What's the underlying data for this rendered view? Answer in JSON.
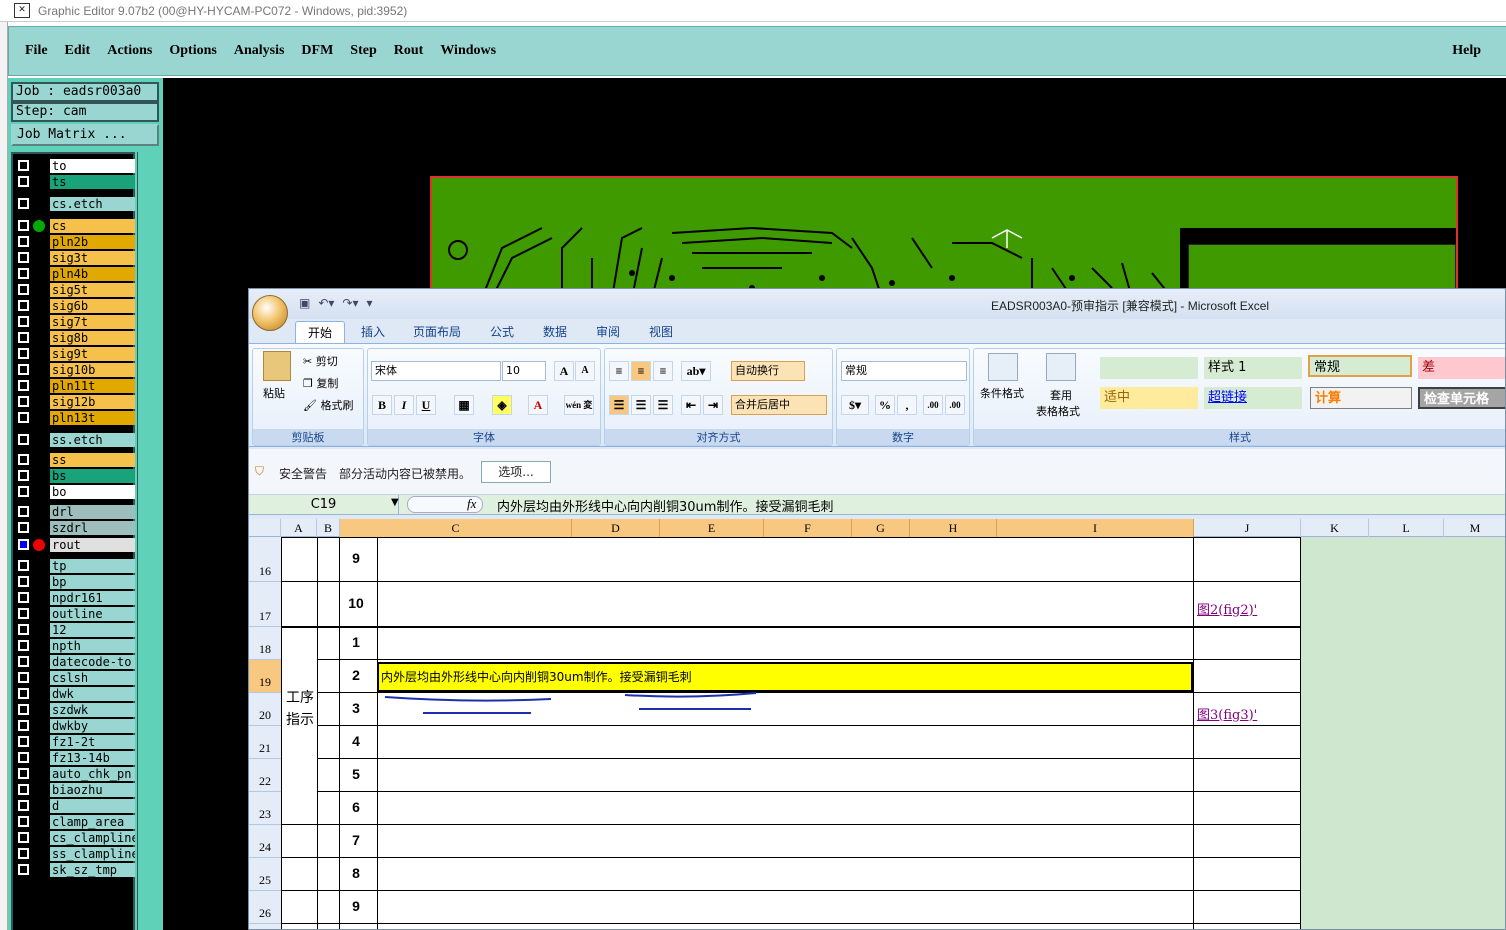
{
  "window": {
    "title": "Graphic Editor 9.07b2 (00@HY-HYCAM-PC072 - Windows, pid:3952)",
    "logo": "GE"
  },
  "menubar": {
    "items": [
      "File",
      "Edit",
      "Actions",
      "Options",
      "Analysis",
      "DFM",
      "Step",
      "Rout",
      "Windows"
    ],
    "help": "Help",
    "bg": "#9ad6d1"
  },
  "job": {
    "job_line": "Job : eadsr003a0",
    "step_line": "Step: cam",
    "matrix_button": "Job Matrix ..."
  },
  "layers": [
    {
      "name": "to",
      "bg": "#ffffff"
    },
    {
      "name": "ts",
      "bg": "#1aa37a"
    },
    {
      "name": "cs.etch",
      "bg": "#9ad6d1"
    },
    {
      "name": "cs",
      "bg": "#f6c14a",
      "dot": "#0a0"
    },
    {
      "name": "pln2b",
      "bg": "#e0a800"
    },
    {
      "name": "sig3t",
      "bg": "#f6c14a"
    },
    {
      "name": "pln4b",
      "bg": "#e0a800"
    },
    {
      "name": "sig5t",
      "bg": "#f6c14a"
    },
    {
      "name": "sig6b",
      "bg": "#f6c14a"
    },
    {
      "name": "sig7t",
      "bg": "#f6c14a"
    },
    {
      "name": "sig8b",
      "bg": "#f6c14a"
    },
    {
      "name": "sig9t",
      "bg": "#f6c14a"
    },
    {
      "name": "sig10b",
      "bg": "#f6c14a"
    },
    {
      "name": "pln11t",
      "bg": "#e0a800"
    },
    {
      "name": "sig12b",
      "bg": "#f6c14a"
    },
    {
      "name": "pln13t",
      "bg": "#e0a800"
    },
    {
      "name": "ss.etch",
      "bg": "#9ad6d1"
    },
    {
      "name": "ss",
      "bg": "#f6c14a"
    },
    {
      "name": "bs",
      "bg": "#1aa37a"
    },
    {
      "name": "bo",
      "bg": "#ffffff"
    },
    {
      "name": "drl",
      "bg": "#9ebdbd"
    },
    {
      "name": "szdrl",
      "bg": "#9ebdbd"
    },
    {
      "name": "rout",
      "bg": "#e0e0e0",
      "dot": "#e00",
      "blue": true
    },
    {
      "name": "tp",
      "bg": "#9ad6d1"
    },
    {
      "name": "bp",
      "bg": "#9ad6d1"
    },
    {
      "name": "npdr161",
      "bg": "#9ad6d1"
    },
    {
      "name": "outline",
      "bg": "#9ad6d1"
    },
    {
      "name": "12",
      "bg": "#9ad6d1"
    },
    {
      "name": "npth",
      "bg": "#9ad6d1"
    },
    {
      "name": "datecode-to",
      "bg": "#9ad6d1"
    },
    {
      "name": "cslsh",
      "bg": "#9ad6d1"
    },
    {
      "name": "dwk",
      "bg": "#9ad6d1"
    },
    {
      "name": "szdwk",
      "bg": "#9ad6d1"
    },
    {
      "name": "dwkby",
      "bg": "#9ad6d1"
    },
    {
      "name": "fz1-2t",
      "bg": "#9ad6d1"
    },
    {
      "name": "fz13-14b",
      "bg": "#9ad6d1"
    },
    {
      "name": "auto_chk_pn",
      "bg": "#9ad6d1"
    },
    {
      "name": "biaozhu",
      "bg": "#9ad6d1"
    },
    {
      "name": "d",
      "bg": "#9ad6d1"
    },
    {
      "name": "clamp_area",
      "bg": "#9ad6d1"
    },
    {
      "name": "cs_clampline",
      "bg": "#9ad6d1"
    },
    {
      "name": "ss_clampline",
      "bg": "#9ad6d1"
    },
    {
      "name": "sk_sz_tmp",
      "bg": "#9ad6d1"
    }
  ],
  "excel": {
    "title": "EADSR003A0-预审指示 [兼容模式] - Microsoft Excel",
    "tabs": [
      "开始",
      "插入",
      "页面布局",
      "公式",
      "数据",
      "审阅",
      "视图"
    ],
    "clipboard": {
      "paste": "粘贴",
      "cut": "剪切",
      "copy": "复制",
      "format_painter": "格式刷",
      "label": "剪贴板"
    },
    "font": {
      "name": "宋体",
      "size": "10",
      "label": "字体",
      "bold": "B",
      "italic": "I",
      "underline": "U",
      "grow": "A",
      "shrink": "A",
      "color": "A",
      "wen": "wén 変"
    },
    "alignment": {
      "wrap": "自动换行",
      "merge": "合并后居中",
      "label": "对齐方式"
    },
    "number": {
      "format": "常规",
      "label": "数字",
      "percent": "%",
      "comma": ",",
      "inc": ".00",
      "dec": ".00"
    },
    "styles_group": {
      "cond": "条件格式",
      "table1": "套用",
      "table2": "表格格式",
      "label": "样式"
    },
    "styles": [
      {
        "text": "",
        "bg": "#d6ecd2",
        "fg": "#000"
      },
      {
        "text": "样式 1",
        "bg": "#d6ecd2",
        "fg": "#000"
      },
      {
        "text": "常规",
        "bg": "#d6ecd2",
        "fg": "#000"
      },
      {
        "text": "差",
        "bg": "#ffc7ce",
        "fg": "#9c0006"
      },
      {
        "text": "适中",
        "bg": "#ffeb9c",
        "fg": "#9c6500"
      },
      {
        "text": "超链接",
        "bg": "#d6ecd2",
        "fg": "#0000ff"
      },
      {
        "text": "计算",
        "bg": "#f2f2f2",
        "fg": "#fa7d00"
      },
      {
        "text": "检查单元格",
        "bg": "#a5a5a5",
        "fg": "#fff"
      }
    ],
    "security": {
      "label": "安全警告",
      "message": "部分活动内容已被禁用。",
      "options": "选项..."
    },
    "formula": {
      "cellref": "C19",
      "fx": "fx",
      "content": "内外层均由外形线中心向内削铜30um制作。接受漏铜毛刺"
    },
    "columns": [
      "A",
      "B",
      "C",
      "D",
      "E",
      "F",
      "G",
      "H",
      "I",
      "J",
      "K",
      "L",
      "M"
    ],
    "rows": [
      {
        "num": "16",
        "b": "9"
      },
      {
        "num": "17",
        "b": "10",
        "link": "图2(fig2)'"
      },
      {
        "num": "18",
        "b": "1"
      },
      {
        "num": "19",
        "b": "2",
        "text": "内外层均由外形线中心向内削铜30um制作。接受漏铜毛刺"
      },
      {
        "num": "20",
        "b": "3",
        "link": "图3(fig3)'"
      },
      {
        "num": "21",
        "b": "4"
      },
      {
        "num": "22",
        "b": "5"
      },
      {
        "num": "23",
        "b": "6"
      },
      {
        "num": "24",
        "b": "7"
      },
      {
        "num": "25",
        "b": "8"
      },
      {
        "num": "26",
        "b": "9"
      }
    ],
    "merged_a": "工序\n指示",
    "selected_fill": "#ffff00"
  }
}
